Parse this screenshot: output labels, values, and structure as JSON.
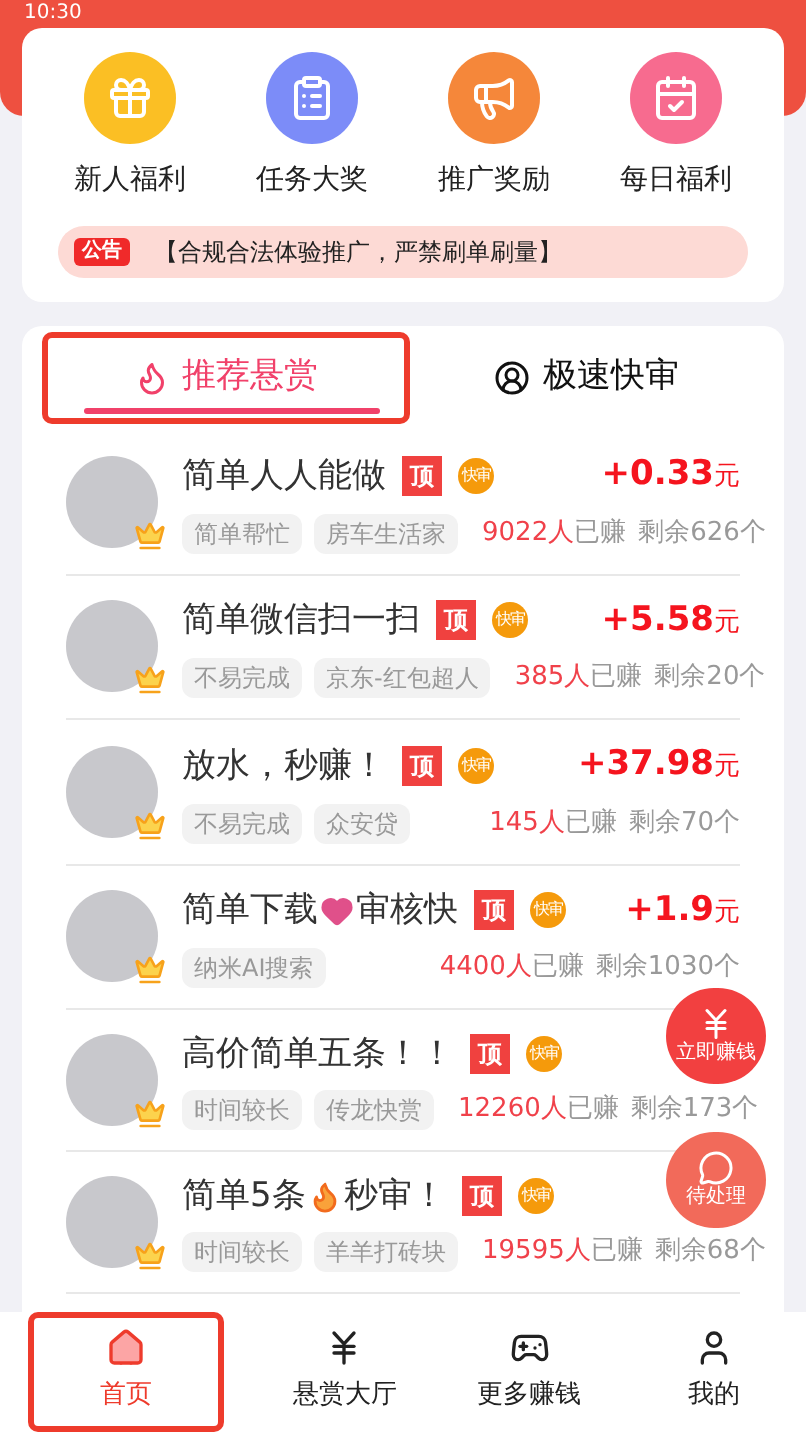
{
  "status_bar": {
    "time": "10:30"
  },
  "shortcuts": [
    {
      "label": "新人福利",
      "kind": "gift"
    },
    {
      "label": "任务大奖",
      "kind": "clipboard"
    },
    {
      "label": "推广奖励",
      "kind": "megaphone"
    },
    {
      "label": "每日福利",
      "kind": "calendar"
    }
  ],
  "notice": {
    "badge": "公告",
    "text": "【合规合法体验推广，严禁刷单刷量】"
  },
  "tabs": [
    {
      "label": "推荐悬赏",
      "selected": true,
      "kind": "flame"
    },
    {
      "label": "极速快审",
      "selected": false,
      "kind": "user"
    }
  ],
  "tasks": [
    {
      "title": [
        "简单人人能做"
      ],
      "kind": "plain",
      "top_badge": "顶",
      "fast_badge": "快审",
      "reward": "+0.33",
      "unit": "元",
      "tags": [
        "简单帮忙",
        "房车生活家"
      ],
      "earned": "9022人",
      "earned_suffix": "已赚",
      "remaining": "剩余626个"
    },
    {
      "title": [
        "简单微信扫一扫"
      ],
      "kind": "plain",
      "top_badge": "顶",
      "fast_badge": "快审",
      "reward": "+5.58",
      "unit": "元",
      "tags": [
        "不易完成",
        "京东-红包超人"
      ],
      "earned": "385人",
      "earned_suffix": "已赚",
      "remaining": "剩余20个"
    },
    {
      "title": [
        "放水，秒赚！"
      ],
      "kind": "plain",
      "top_badge": "顶",
      "fast_badge": "快审",
      "reward": "+37.98",
      "unit": "元",
      "tags": [
        "不易完成",
        "众安贷"
      ],
      "earned": "145人",
      "earned_suffix": "已赚",
      "remaining": "剩余70个"
    },
    {
      "title": [
        "简单下载",
        "审核快"
      ],
      "kind": "heart",
      "top_badge": "顶",
      "fast_badge": "快审",
      "reward": "+1.9",
      "unit": "元",
      "tags": [
        "纳米AI搜索"
      ],
      "earned": "4400人",
      "earned_suffix": "已赚",
      "remaining": "剩余1030个"
    },
    {
      "title": [
        "高价简单五条！！"
      ],
      "kind": "plain",
      "top_badge": "顶",
      "fast_badge": "快审",
      "tags": [
        "时间较长",
        "传龙快赏"
      ],
      "earned": "12260人",
      "earned_suffix": "已赚",
      "remaining": "剩余173个"
    },
    {
      "title": [
        "简单5条",
        "秒审！"
      ],
      "kind": "fire",
      "top_badge": "顶",
      "fast_badge": "快审",
      "tags": [
        "时间较长",
        "羊羊打砖块"
      ],
      "earned": "19595人",
      "earned_suffix": "已赚",
      "remaining": "剩余68个"
    }
  ],
  "floating_buttons": [
    {
      "label": "立即赚钱",
      "kind": "money"
    },
    {
      "label": "待处理",
      "kind": "chat"
    }
  ],
  "bottom_nav": [
    {
      "label": "首页",
      "selected": true,
      "kind": "home"
    },
    {
      "label": "悬赏大厅",
      "selected": false,
      "kind": "yen"
    },
    {
      "label": "更多赚钱",
      "selected": false,
      "kind": "gamepad"
    },
    {
      "label": "我的",
      "selected": false,
      "kind": "user"
    }
  ]
}
